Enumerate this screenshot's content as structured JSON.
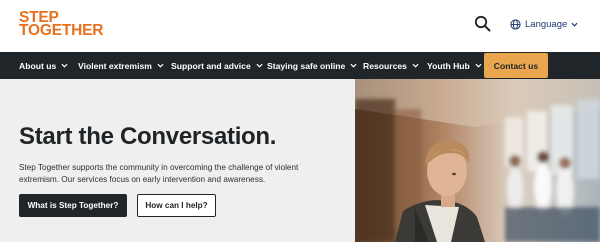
{
  "header": {
    "logo_line1": "STEP",
    "logo_line2": "TOGETHER",
    "search_icon": "search-icon",
    "language_label": "Language",
    "language_icon": "globe-icon"
  },
  "nav": {
    "items": [
      {
        "label": "About us"
      },
      {
        "label": "Violent extremism"
      },
      {
        "label": "Support and advice"
      },
      {
        "label": "Staying safe online"
      },
      {
        "label": "Resources"
      },
      {
        "label": "Youth Hub"
      }
    ],
    "contact_label": "Contact us"
  },
  "hero": {
    "title": "Start the Conversation.",
    "description": "Step Together supports the community in overcoming the challenge of violent extremism. Our services focus on early intervention and awareness.",
    "primary_button": "What is Step Together?",
    "secondary_button": "How can I help?"
  },
  "colors": {
    "brand_orange": "#e8721c",
    "nav_dark": "#20252a",
    "contact_button": "#eaa64f",
    "hero_background": "#efefef",
    "language_blue": "#1e3a70"
  }
}
